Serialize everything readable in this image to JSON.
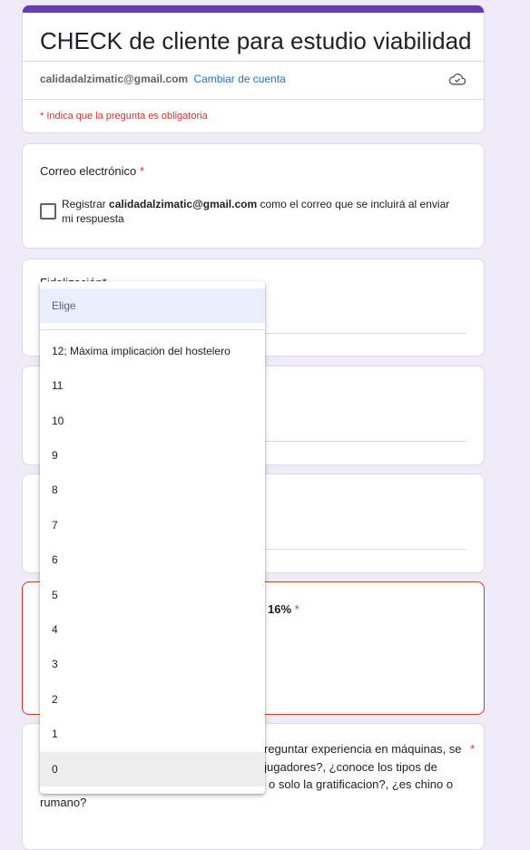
{
  "form": {
    "title": "CHECK de cliente para estudio viabilidad",
    "account_email": "calidadalzimatic@gmail.com",
    "switch_account": "Cambiar de cuenta",
    "required_note": "* Indica que la pregunta es obligatoria",
    "accent_color": "#673ab7",
    "cloud_icon": "cloud-icon"
  },
  "email_question": {
    "label": "Correo electrónico",
    "asterisk": "*",
    "checkbox_prefix": "Registrar",
    "checkbox_email": "calidadalzimatic@gmail.com",
    "checkbox_suffix": "como el correo que se incluirá al enviar mi respuesta",
    "checked": false
  },
  "partial_questions": {
    "card3_label": "Fidelización*",
    "error_card_text": "16%",
    "error_card_asterisk": "*",
    "last_question_text": "reguntar experiencia en máquinas, se",
    "last_question_line2": "s jugadores?, ¿conoce los tipos de",
    "last_question_line3": "o solo la gratificacion?, ¿es chino o",
    "last_question_line4": "rumano?",
    "last_question_asterisk": "*"
  },
  "dropdown": {
    "placeholder": "Elige",
    "options": [
      "12; Máxima implicación del hostelero",
      "11",
      "10",
      "9",
      "8",
      "7",
      "6",
      "5",
      "4",
      "3",
      "2",
      "1",
      "0"
    ],
    "hovered_option": "0"
  }
}
